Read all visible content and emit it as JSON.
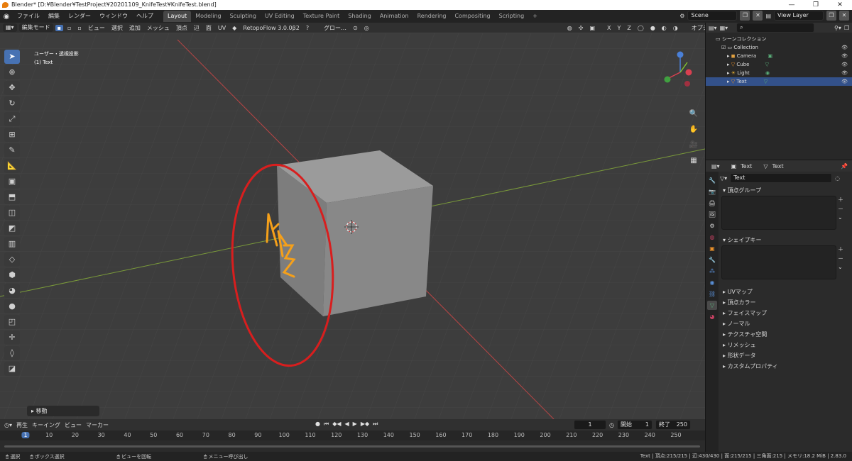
{
  "window": {
    "title": "Blender* [D:¥Blender¥TestProject¥20201109_KnifeTest¥KnifeTest.blend]",
    "controls": [
      "—",
      "❐",
      "✕"
    ]
  },
  "menus": [
    "ファイル",
    "編集",
    "レンダー",
    "ウィンドウ",
    "ヘルプ"
  ],
  "workspaces": [
    {
      "label": "Layout",
      "active": true
    },
    {
      "label": "Modeling"
    },
    {
      "label": "Sculpting"
    },
    {
      "label": "UV Editing"
    },
    {
      "label": "Texture Paint"
    },
    {
      "label": "Shading"
    },
    {
      "label": "Animation"
    },
    {
      "label": "Rendering"
    },
    {
      "label": "Compositing"
    },
    {
      "label": "Scripting"
    },
    {
      "label": "+"
    }
  ],
  "scene": {
    "name": "Scene",
    "view_layer": "View Layer"
  },
  "viewport": {
    "mode": "編集モード",
    "header_menus": [
      "ビュー",
      "選択",
      "追加",
      "メッシュ",
      "頂点",
      "辺",
      "面",
      "UV"
    ],
    "addon": "RetopoFlow 3.0.0β2",
    "orientation": "グロー…",
    "options_label": "オプション",
    "axis_labels": [
      "X",
      "Y",
      "Z"
    ],
    "view_name": "ユーザー・透視投影",
    "object_label": "(1) Text",
    "last_operator": "移動"
  },
  "timeline": {
    "menus": [
      "再生",
      "キーイング",
      "ビュー",
      "マーカー"
    ],
    "current_frame": "1",
    "start_label": "開始",
    "start": "1",
    "end_label": "終了",
    "end": "250",
    "ticks": [
      "1",
      "10",
      "20",
      "30",
      "40",
      "50",
      "60",
      "70",
      "80",
      "90",
      "100",
      "110",
      "120",
      "130",
      "140",
      "150",
      "160",
      "170",
      "180",
      "190",
      "200",
      "210",
      "220",
      "230",
      "240",
      "250"
    ]
  },
  "statusbar": {
    "items": [
      "選択",
      "ボックス選択",
      "ビューを回転",
      "メニュー呼び出し"
    ],
    "stats": "Text | 頂点:215/215 | 辺:430/430 | 面:215/215 | 三角面:215 | メモリ:18.2 MiB | 2.83.0"
  },
  "outliner": {
    "root": "シーンコレクション",
    "collection": "Collection",
    "objects": [
      {
        "name": "Camera",
        "color": "#e0a040"
      },
      {
        "name": "Cube",
        "color": "#e8902a"
      },
      {
        "name": "Light",
        "color": "#e8b030"
      },
      {
        "name": "Text",
        "color": "#e8902a",
        "selected": true
      }
    ]
  },
  "properties": {
    "breadcrumb_object": "Text",
    "breadcrumb_data": "Text",
    "data_name": "Text",
    "vertex_groups": "頂点グループ",
    "shape_keys": "シェイプキー",
    "collapsed_panels": [
      "UVマップ",
      "頂点カラー",
      "フェイスマップ",
      "ノーマル",
      "テクスチャ空間",
      "リメッシュ",
      "形状データ",
      "カスタムプロパティ"
    ]
  },
  "colors": {
    "accent": "#4772b3",
    "selection_orange": "#f5a01a",
    "annotation_red": "#d81e1e"
  }
}
